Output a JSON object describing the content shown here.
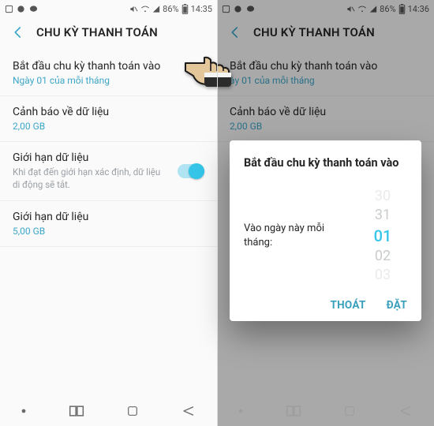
{
  "left": {
    "status": {
      "battery": "86%",
      "time": "14:35"
    },
    "header_title": "CHU KỲ THANH TOÁN",
    "items": {
      "billing_start": {
        "title": "Bắt đầu chu kỳ thanh toán vào",
        "sub": "Ngày 01 của mỗi tháng"
      },
      "data_warning": {
        "title": "Cảnh báo về dữ liệu",
        "sub": "2,00 GB"
      },
      "data_limit_toggle": {
        "title": "Giới hạn dữ liệu",
        "desc": "Khi đạt đến giới hạn xác định, dữ liệu di động sẽ tắt."
      },
      "data_limit": {
        "title": "Giới hạn dữ liệu",
        "sub": "5,00 GB"
      }
    }
  },
  "right": {
    "status": {
      "battery": "86%",
      "time": "14:36"
    },
    "header_title": "CHU KỲ THANH TOÁN",
    "items": {
      "billing_start": {
        "title": "Bắt đầu chu kỳ thanh toán vào",
        "sub": "ày 01 của mỗi tháng"
      },
      "data_warning": {
        "title": "Cảnh báo về dữ liệu",
        "sub": "2,00 GB"
      }
    },
    "dialog": {
      "title": "Bắt đầu chu kỳ thanh toán vào",
      "label": "Vào ngày này mỗi tháng:",
      "options": [
        "30",
        "31",
        "01",
        "02",
        "03"
      ],
      "selected": "01",
      "cancel": "THOÁT",
      "ok": "ĐẶT"
    }
  }
}
